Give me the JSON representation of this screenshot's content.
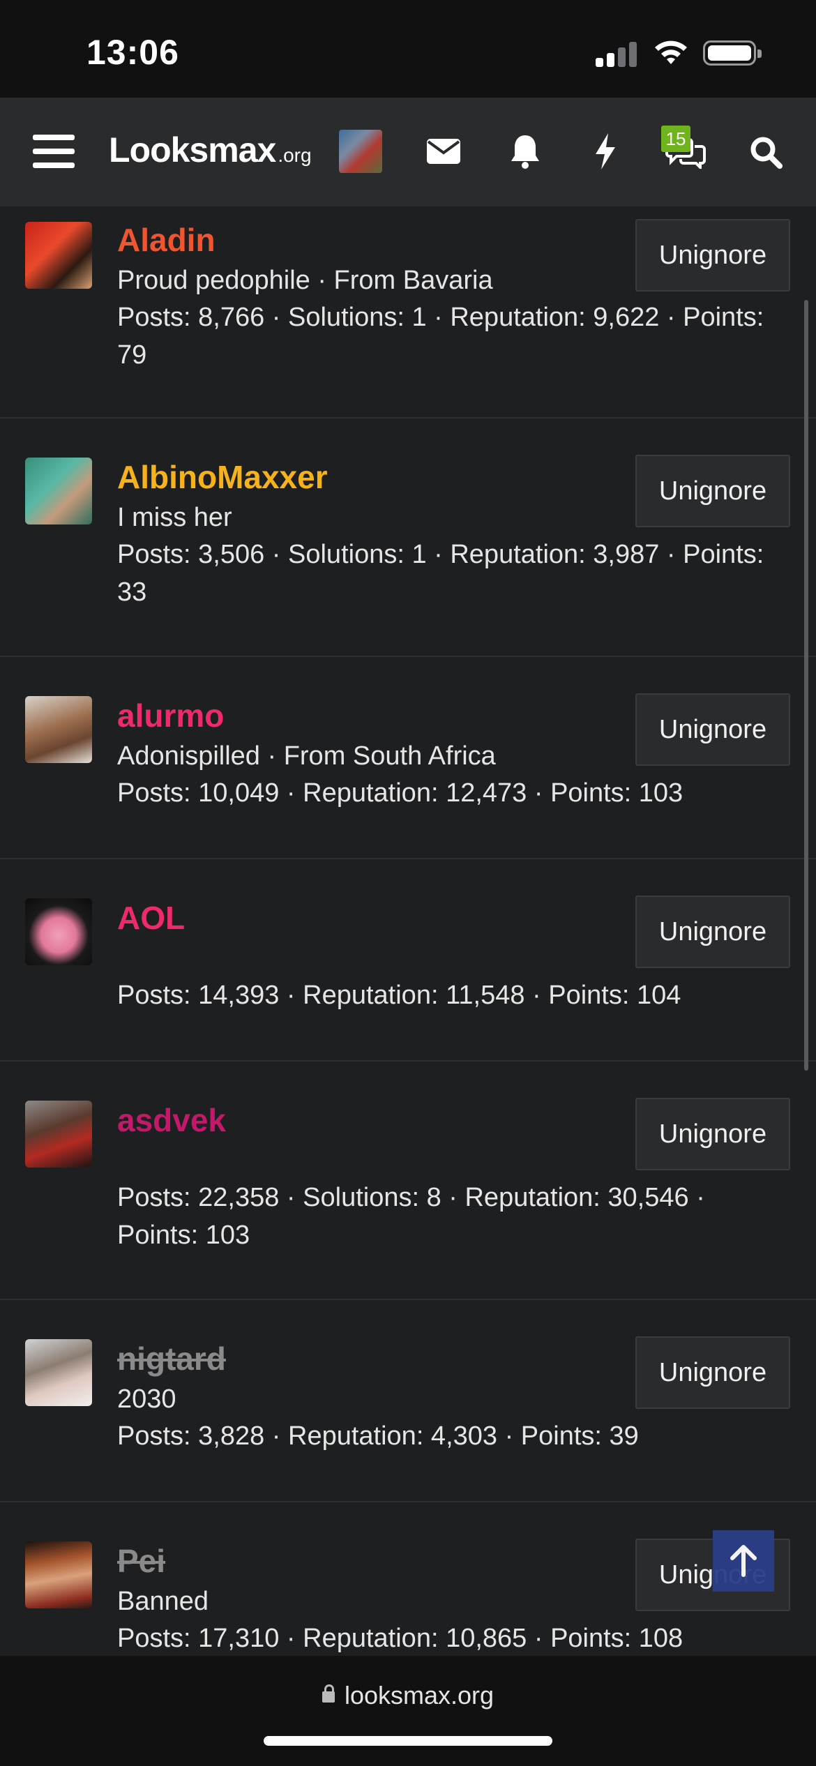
{
  "status_bar": {
    "time": "13:06"
  },
  "nav": {
    "logo_main": "Looksmax",
    "logo_suffix": ".org",
    "conversations_badge": "15",
    "icons": [
      "menu-icon",
      "avatar",
      "envelope-icon",
      "bell-icon",
      "bolt-icon",
      "chat-bubbles-icon",
      "search-icon"
    ]
  },
  "members": [
    {
      "name": "Aladin",
      "color": "#f0552e",
      "banned": false,
      "title": "Proud pedophile · From Bavaria",
      "stats": "Posts: 8,766 · Solutions: 1 · Reputation: 9,622 · Points: 79",
      "button": "Unignore"
    },
    {
      "name": "AlbinoMaxxer",
      "color": "#f5b21b",
      "banned": false,
      "title": "I miss her",
      "stats": "Posts: 3,506 · Solutions: 1 · Reputation: 3,987 · Points: 33",
      "button": "Unignore"
    },
    {
      "name": "alurmo",
      "color": "#ee2a6b",
      "banned": false,
      "title": "Adonispilled · From South Africa",
      "stats": "Posts: 10,049 · Reputation: 12,473 · Points: 103",
      "button": "Unignore"
    },
    {
      "name": "AOL",
      "color": "#ee2a6b",
      "banned": false,
      "title": "",
      "stats": "Posts: 14,393 · Reputation: 11,548 · Points: 104",
      "button": "Unignore"
    },
    {
      "name": "asdvek",
      "color": "#c4186a",
      "banned": false,
      "title": "",
      "stats": "Posts: 22,358 · Solutions: 8 · Reputation: 30,546 · Points: 103",
      "button": "Unignore"
    },
    {
      "name": "nigtard",
      "color": "#8a8a8a",
      "banned": true,
      "title": "2030",
      "stats": "Posts: 3,828 · Reputation: 4,303 · Points: 39",
      "button": "Unignore"
    },
    {
      "name": "Pei",
      "color": "#8a8a8a",
      "banned": true,
      "title": "Banned",
      "stats": "Posts: 17,310 · Reputation: 10,865 · Points: 108",
      "button": "Unignore"
    }
  ],
  "browser": {
    "url": "looksmax.org"
  }
}
